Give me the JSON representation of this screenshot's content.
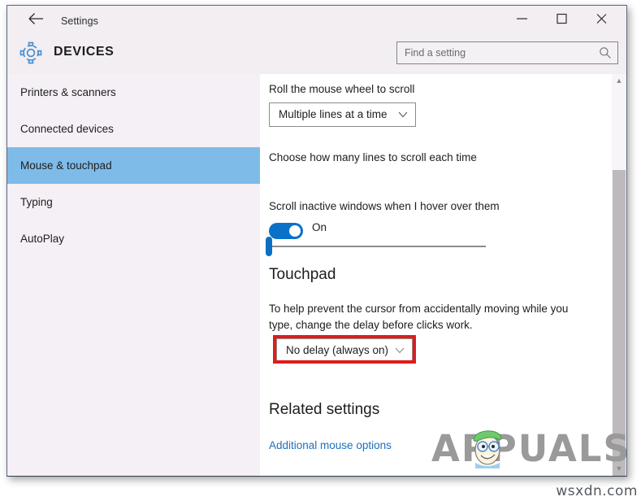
{
  "window": {
    "title": "Settings",
    "back_icon": "back-arrow-icon",
    "controls": {
      "minimize": "─",
      "maximize": "☐",
      "close": "✕"
    }
  },
  "header": {
    "icon": "gear-icon",
    "title": "DEVICES",
    "search": {
      "placeholder": "Find a setting",
      "value": "",
      "icon": "search-icon"
    }
  },
  "sidebar": {
    "items": [
      {
        "label": "Printers & scanners",
        "selected": false
      },
      {
        "label": "Connected devices",
        "selected": false
      },
      {
        "label": "Mouse & touchpad",
        "selected": true
      },
      {
        "label": "Typing",
        "selected": false
      },
      {
        "label": "AutoPlay",
        "selected": false
      }
    ],
    "selected_color": "#7ebbe8"
  },
  "main": {
    "mouse": {
      "wheel_label": "Roll the mouse wheel to scroll",
      "wheel_value": "Multiple lines at a time",
      "lines_label": "Choose how many lines to scroll each time",
      "slider_value": 1,
      "slider_min": 1,
      "slider_max": 100,
      "inactive_label": "Scroll inactive windows when I hover over them",
      "inactive_toggle_state": "On"
    },
    "touchpad": {
      "heading": "Touchpad",
      "description": "To help prevent the cursor from accidentally moving while you type, change the delay before clicks work.",
      "delay_value": "No delay (always on)"
    },
    "related": {
      "heading": "Related settings",
      "link": "Additional mouse options"
    }
  },
  "annotation": {
    "highlight_color": "#e01b1b",
    "target": "No delay (always on)"
  },
  "watermarks": {
    "brand": "APPUALS",
    "site": "wsxdn.com"
  },
  "colors": {
    "accent": "#0a71c8",
    "window_chrome": "#f2eef2",
    "content_bg": "#ffffff"
  }
}
